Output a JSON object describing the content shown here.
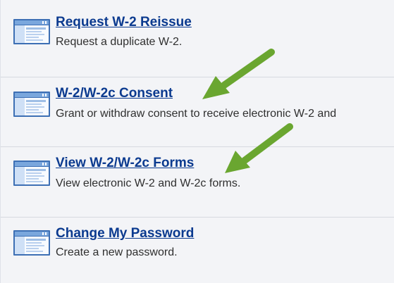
{
  "menu": {
    "items": [
      {
        "title": "Request W-2 Reissue",
        "description": "Request a duplicate W-2.",
        "icon": "form-window-icon"
      },
      {
        "title": "W-2/W-2c Consent",
        "description": "Grant or withdraw consent to receive electronic W-2 and",
        "icon": "form-window-icon"
      },
      {
        "title": "View W-2/W-2c Forms",
        "description": "View electronic W-2 and W-2c forms.",
        "icon": "form-window-icon"
      },
      {
        "title": "Change My Password",
        "description": "Create a new password.",
        "icon": "form-window-icon"
      }
    ]
  },
  "colors": {
    "background": "#f3f4f7",
    "link": "#0b3a8f",
    "divider": "#d6d9df",
    "arrow": "#6aa630",
    "icon_primary": "#3d6fb4",
    "icon_light": "#dbe8f8"
  }
}
